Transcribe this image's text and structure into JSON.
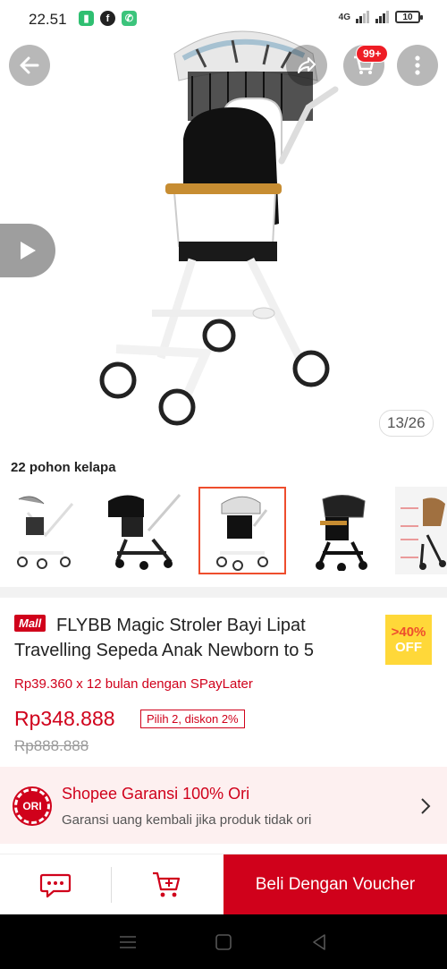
{
  "status_bar": {
    "time": "22.51",
    "network": "4G",
    "battery": "10"
  },
  "gallery": {
    "page_counter": "13/26",
    "cart_badge": "99+"
  },
  "variant": {
    "title": "22 pohon kelapa",
    "thumbnails": [
      "white-grey",
      "black",
      "tropical-white",
      "black-pattern",
      "annotated-detail"
    ],
    "selected_index": 2
  },
  "product": {
    "mall_badge": "Mall",
    "title": "FLYBB Magic Stroler Bayi Lipat Travelling Sepeda Anak Newborn to 5",
    "discount_pct": ">40%",
    "discount_off": "OFF",
    "spaylater": "Rp39.360 x 12 bulan dengan SPayLater",
    "price": "Rp348.888",
    "promo": "Pilih 2, diskon 2%",
    "old_price": "Rp888.888"
  },
  "guarantee": {
    "icon_label": "ORI",
    "title": "Shopee Garansi 100% Ori",
    "subtitle": "Garansi uang kembali jika produk tidak ori"
  },
  "bottom_bar": {
    "buy_label": "Beli Dengan Voucher"
  },
  "colors": {
    "brand_red": "#d0011b",
    "shopee_orange": "#ee4d2d",
    "discount_yellow": "#ffd839"
  }
}
